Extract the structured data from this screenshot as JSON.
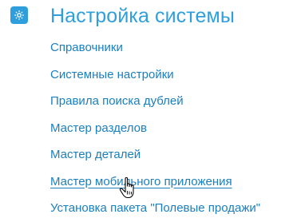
{
  "section": {
    "title": "Настройка системы",
    "icon": "gear-icon",
    "accent_color": "#2e9fdc",
    "link_color": "#1a7fbf"
  },
  "menu": {
    "items": [
      {
        "label": "Справочники"
      },
      {
        "label": "Системные настройки"
      },
      {
        "label": "Правила поиска дублей"
      },
      {
        "label": "Мастер разделов"
      },
      {
        "label": "Мастер деталей"
      },
      {
        "label": "Мастер мобильного приложения",
        "hovered": true
      },
      {
        "label": "Установка пакета \"Полевые продажи\""
      }
    ]
  },
  "cursor": {
    "icon": "hand-pointer-icon"
  }
}
